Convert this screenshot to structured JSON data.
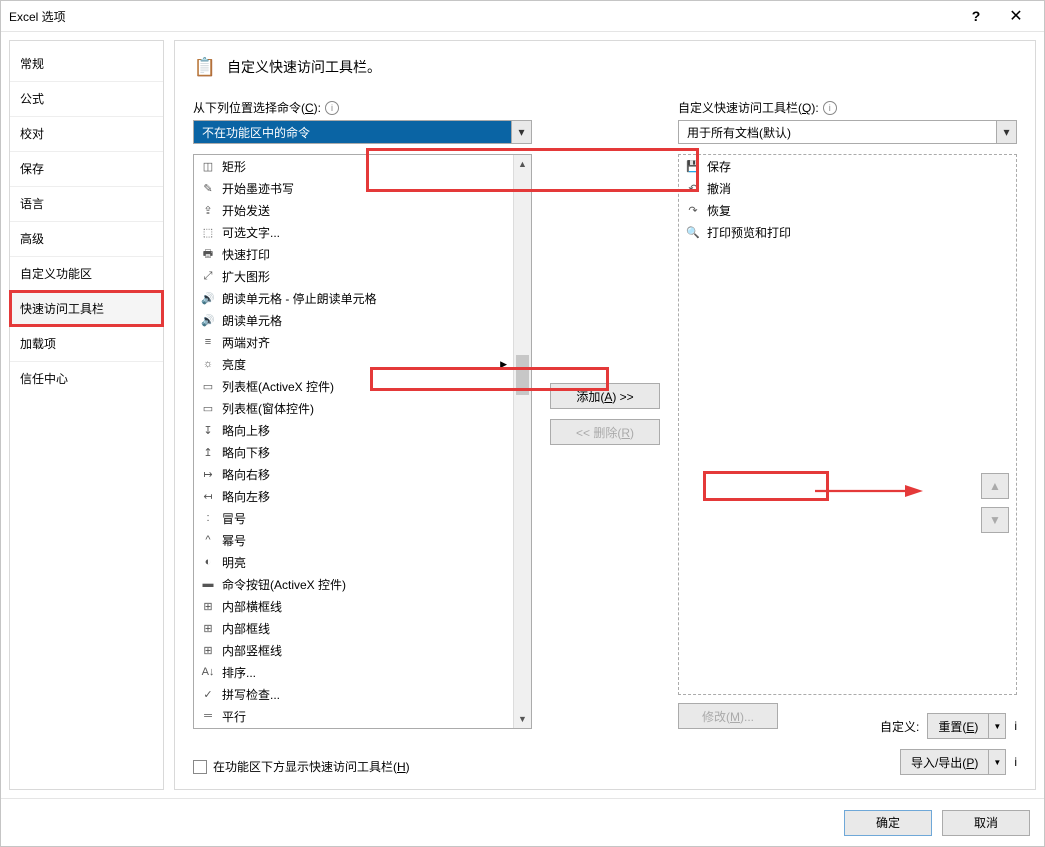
{
  "titlebar": {
    "title": "Excel 选项",
    "help": "?",
    "close": "✕"
  },
  "sidebar": {
    "items": [
      {
        "label": "常规"
      },
      {
        "label": "公式"
      },
      {
        "label": "校对"
      },
      {
        "label": "保存"
      },
      {
        "label": "语言"
      },
      {
        "label": "高级"
      },
      {
        "label": "自定义功能区"
      },
      {
        "label": "快速访问工具栏"
      },
      {
        "label": "加载项"
      },
      {
        "label": "信任中心"
      }
    ]
  },
  "header": {
    "title": "自定义快速访问工具栏。"
  },
  "left": {
    "label_prefix": "从下列位置选择命令(",
    "label_key": "C",
    "label_suffix": "):",
    "combo": "不在功能区中的命令",
    "items": [
      {
        "icon": "◫",
        "label": "矩形"
      },
      {
        "icon": "✎",
        "label": "开始墨迹书写"
      },
      {
        "icon": "⇪",
        "label": "开始发送"
      },
      {
        "icon": "⬚",
        "label": "可选文字..."
      },
      {
        "icon": "🖶",
        "label": "快速打印"
      },
      {
        "icon": "⤢",
        "label": "扩大图形"
      },
      {
        "icon": "🔊",
        "label": "朗读单元格 - 停止朗读单元格"
      },
      {
        "icon": "🔊",
        "label": "朗读单元格"
      },
      {
        "icon": "≡",
        "label": "两端对齐"
      },
      {
        "icon": "☼",
        "label": "亮度",
        "sub": true
      },
      {
        "icon": "▭",
        "label": "列表框(ActiveX 控件)"
      },
      {
        "icon": "▭",
        "label": "列表框(窗体控件)"
      },
      {
        "icon": "↧",
        "label": "略向上移"
      },
      {
        "icon": "↥",
        "label": "略向下移"
      },
      {
        "icon": "↦",
        "label": "略向右移"
      },
      {
        "icon": "↤",
        "label": "略向左移"
      },
      {
        "icon": ":",
        "label": "冒号"
      },
      {
        "icon": "^",
        "label": "幂号"
      },
      {
        "icon": "◐",
        "label": "明亮"
      },
      {
        "icon": "▬",
        "label": "命令按钮(ActiveX 控件)"
      },
      {
        "icon": "⊞",
        "label": "内部横框线"
      },
      {
        "icon": "⊞",
        "label": "内部框线"
      },
      {
        "icon": "⊞",
        "label": "内部竖框线"
      },
      {
        "icon": "A↓",
        "label": "排序..."
      },
      {
        "icon": "✓",
        "label": "拼写检查..."
      },
      {
        "icon": "═",
        "label": "平行"
      }
    ]
  },
  "right": {
    "label_prefix": "自定义快速访问工具栏(",
    "label_key": "Q",
    "label_suffix": "):",
    "combo": "用于所有文档(默认)",
    "items": [
      {
        "icon": "💾",
        "label": "保存"
      },
      {
        "icon": "↶",
        "label": "撤消"
      },
      {
        "icon": "↷",
        "label": "恢复"
      },
      {
        "icon": "🔍",
        "label": "打印预览和打印"
      }
    ]
  },
  "buttons": {
    "add_prefix": "添加(",
    "add_key": "A",
    "add_suffix": ") >>",
    "remove_prefix": "<< 删除(",
    "remove_key": "R",
    "remove_suffix": ")",
    "modify_prefix": "修改(",
    "modify_key": "M",
    "modify_suffix": ")...",
    "up": "▲",
    "down": "▼"
  },
  "checkbox": {
    "prefix": "在功能区下方显示快速访问工具栏(",
    "key": "H",
    "suffix": ")"
  },
  "reset": {
    "label": "自定义:",
    "reset_prefix": "重置(",
    "reset_key": "E",
    "reset_suffix": ")",
    "import_prefix": "导入/导出(",
    "import_key": "P",
    "import_suffix": ")"
  },
  "footer": {
    "ok": "确定",
    "cancel": "取消"
  }
}
